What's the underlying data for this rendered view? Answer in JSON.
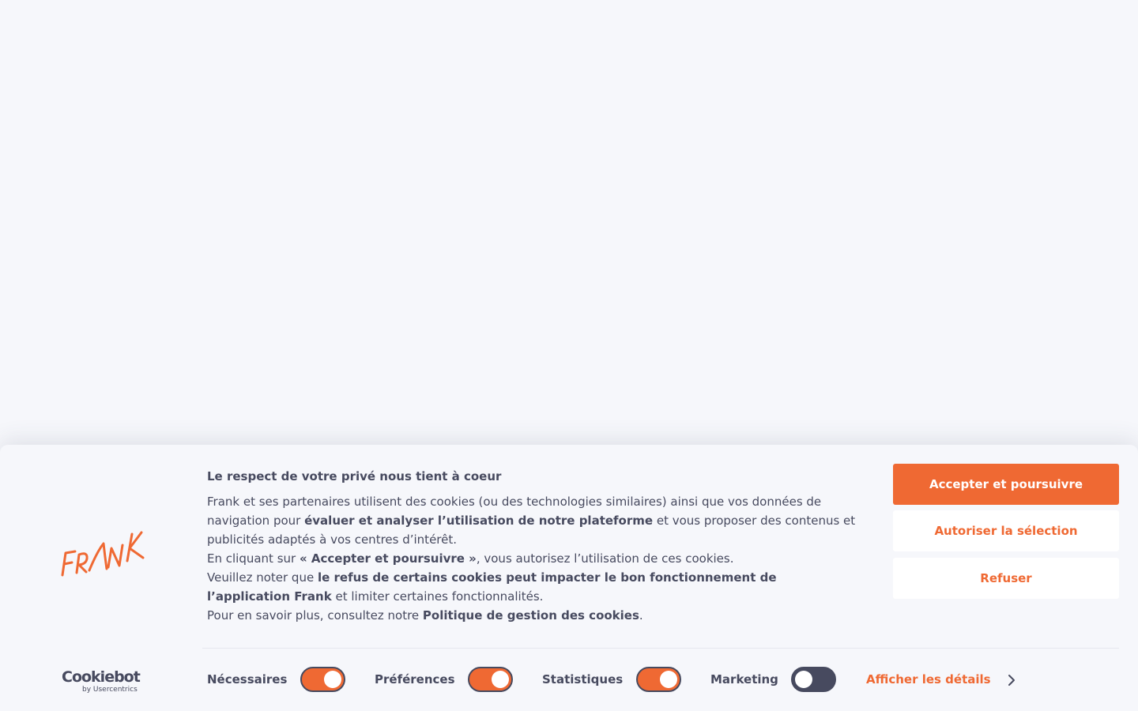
{
  "colors": {
    "accent": "#ef6933",
    "text": "#474a5f",
    "background": "#f6f7fb",
    "button_bg": "#ffffff"
  },
  "brand": {
    "logo_text": "FRANK",
    "cmp_logo_text": "Cookiebot",
    "cmp_logo_subtext": "by Usercentrics"
  },
  "banner": {
    "title": "Le respect de votre privé nous tient à coeur",
    "p1_a": "Frank et ses partenaires utilisent des cookies (ou des technologies similaires) ainsi que vos données de navigation pour ",
    "p1_b": "évaluer et analyser l’utilisation de notre plateforme",
    "p1_c": " et vous proposer des contenus et publicités adaptés à vos centres d’intérêt.",
    "p2_a": "En cliquant sur ",
    "p2_b": "« Accepter et poursuivre »",
    "p2_c": ", vous autorisez l’utilisation de ces cookies.",
    "p3_a": "Veuillez noter que ",
    "p3_b": "le refus de certains cookies peut impacter le bon fonctionnement de l’application Frank",
    "p3_c": " et limiter certaines fonctionnalités.",
    "p4_a": "Pour en savoir plus, consultez notre ",
    "p4_b": "Politique de gestion des cookies",
    "p4_c": "."
  },
  "buttons": {
    "accept": "Accepter et poursuivre",
    "allow_selection": "Autoriser la sélection",
    "deny": "Refuser"
  },
  "consent": {
    "necessary": {
      "label": "Nécessaires",
      "checked": true
    },
    "preferences": {
      "label": "Préférences",
      "checked": true
    },
    "statistics": {
      "label": "Statistiques",
      "checked": true
    },
    "marketing": {
      "label": "Marketing",
      "checked": false
    }
  },
  "details_link": "Afficher les détails",
  "icons": {
    "chevron": "chevron-right-icon",
    "logo": "frank-logo",
    "cmp_logo": "cookiebot-logo"
  }
}
